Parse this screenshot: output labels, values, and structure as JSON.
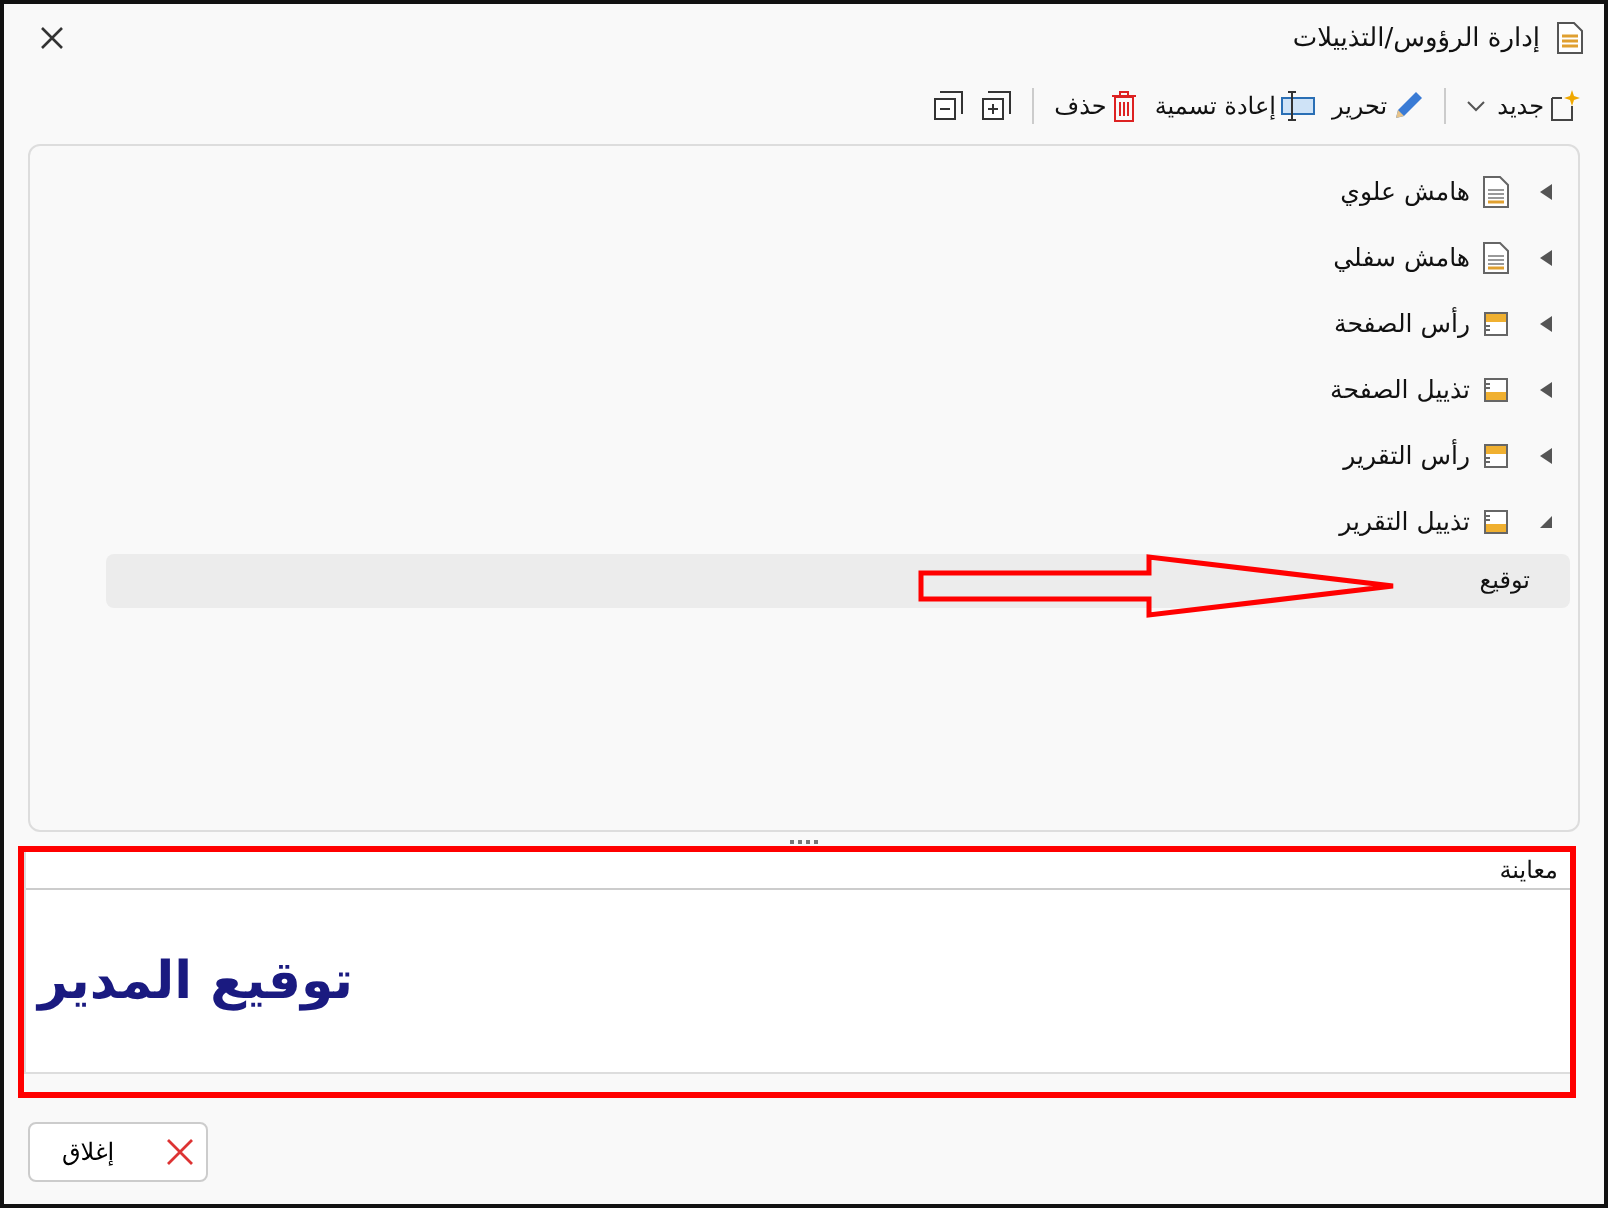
{
  "window": {
    "title": "إدارة الرؤوس/التذييلات"
  },
  "toolbar": [
    {
      "kind": "new",
      "label": "جديد"
    },
    {
      "kind": "edit",
      "label": "تحرير"
    },
    {
      "kind": "rename",
      "label": "إعادة تسمية"
    },
    {
      "kind": "delete",
      "label": "حذف"
    },
    {
      "kind": "expand-all"
    },
    {
      "kind": "collapse-all"
    }
  ],
  "tree": [
    {
      "label": "هامش علوي",
      "kind": "page",
      "expanded": false
    },
    {
      "label": "هامش سفلي",
      "kind": "page",
      "expanded": false
    },
    {
      "label": "رأس الصفحة",
      "kind": "header",
      "expanded": false
    },
    {
      "label": "تذييل الصفحة",
      "kind": "footer",
      "expanded": false
    },
    {
      "label": "رأس التقرير",
      "kind": "header",
      "expanded": false
    },
    {
      "label": "تذييل التقرير",
      "kind": "footer",
      "expanded": true,
      "children": [
        {
          "label": "توقيع",
          "selected": true
        }
      ]
    }
  ],
  "preview": {
    "label": "معاينة",
    "text": "توقيع المدير"
  },
  "buttons": [
    {
      "label": "إغلاق"
    }
  ]
}
